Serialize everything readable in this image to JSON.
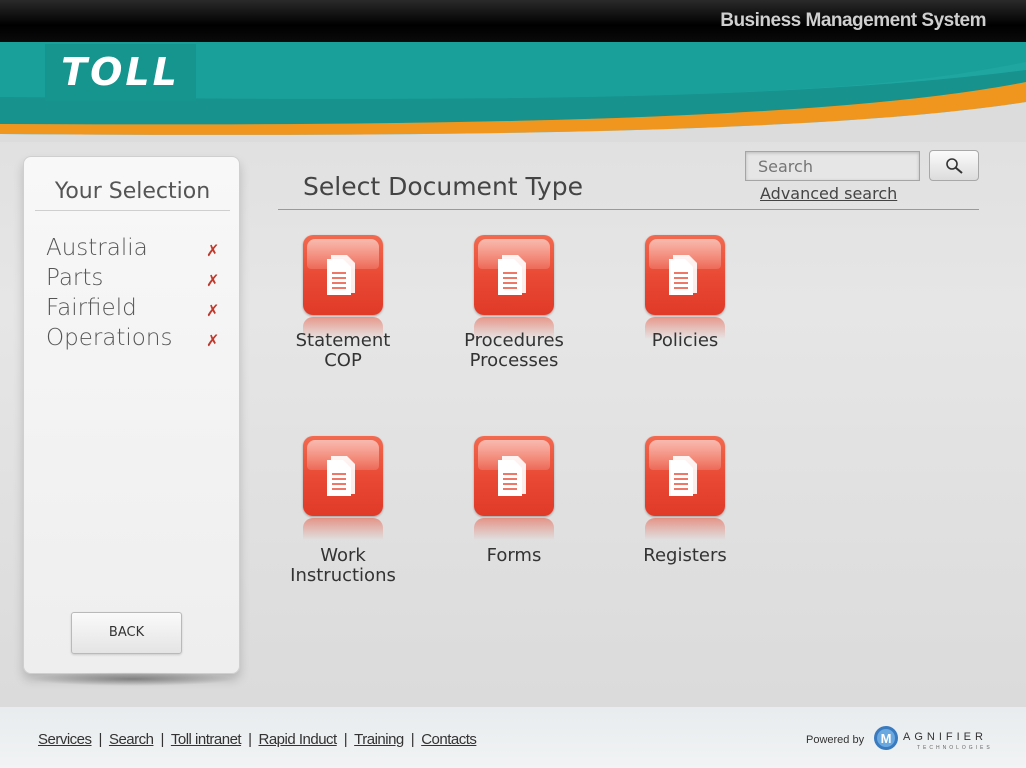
{
  "header": {
    "app_title": "Business Management System",
    "logo_text": "TOLL"
  },
  "selection": {
    "title": "Your Selection",
    "items": [
      {
        "label": "Australia"
      },
      {
        "label": "Parts"
      },
      {
        "label": "Fairfield"
      },
      {
        "label": "Operations"
      }
    ],
    "remove_icon": "✗",
    "back_label": "BACK"
  },
  "main": {
    "title": "Select Document Type",
    "search_placeholder": "Search",
    "advanced_search": "Advanced search",
    "doc_types": [
      {
        "line1": "Statement",
        "line2": "COP"
      },
      {
        "line1": "Procedures",
        "line2": "Processes"
      },
      {
        "line1": "Policies",
        "line2": ""
      },
      {
        "line1": "Work",
        "line2": "Instructions"
      },
      {
        "line1": "Forms",
        "line2": ""
      },
      {
        "line1": "Registers",
        "line2": ""
      }
    ]
  },
  "footer": {
    "links": [
      "Services",
      "Search",
      "Toll intranet",
      "Rapid Induct",
      "Training",
      "Contacts"
    ],
    "separator": "|",
    "powered_by": "Powered by",
    "brand": "AGNIFIER",
    "brand_sub": "TECHNOLOGIES"
  },
  "colors": {
    "teal": "#16958f",
    "orange": "#f0961f",
    "tile_red": "#e94a35",
    "remove_red": "#c0392b"
  }
}
